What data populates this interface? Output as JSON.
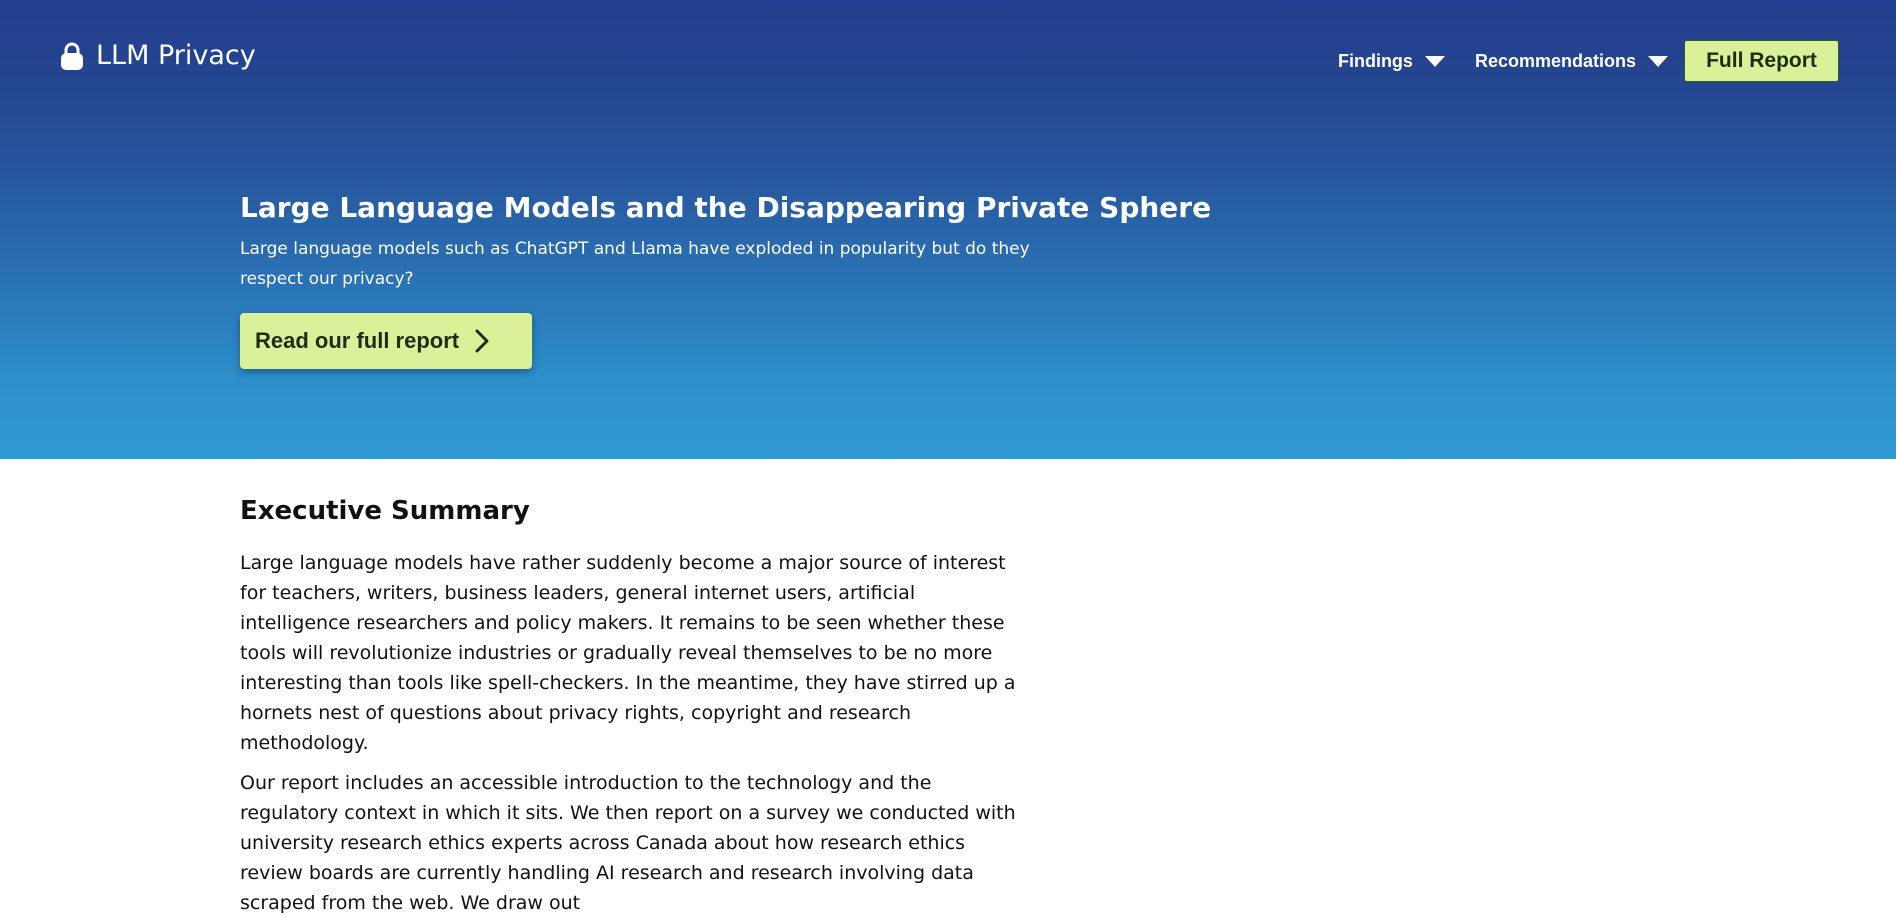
{
  "header": {
    "brand": {
      "icon": "lock-icon",
      "name": "LLM Privacy"
    },
    "nav": {
      "findings_label": "Findings",
      "recommendations_label": "Recommendations",
      "full_report_label": "Full Report",
      "dropdown_icon": "caret-down-icon"
    }
  },
  "hero": {
    "title": "Large Language Models and the Disappearing Private Sphere",
    "subtitle": "Large language models such as ChatGPT and Llama have exploded in popularity but do they respect our privacy?",
    "cta_label": "Read our full report",
    "cta_icon": "chevron-right-icon"
  },
  "summary": {
    "heading": "Executive Summary",
    "paragraphs": [
      "Large language models have rather suddenly become a major source of interest for teachers, writers, business leaders, general internet users, artificial intelligence researchers and policy makers. It remains to be seen whether these tools will revolutionize industries or gradually reveal themselves to be no more interesting than tools like spell-checkers. In the meantime, they have stirred up a hornets nest of questions about privacy rights, copyright and research methodology.",
      "Our report includes an accessible introduction to the technology and the regulatory context in which it sits. We then report on a survey we conducted with university research ethics experts across Canada about how research ethics review boards are currently handling AI research and research involving data scraped from the web. We draw out"
    ]
  },
  "colors": {
    "hero_top": "#233f8f",
    "hero_bottom": "#2e9ad3",
    "accent_button": "#d9f29a",
    "button_text": "#1e2d17",
    "text": "#111111"
  }
}
